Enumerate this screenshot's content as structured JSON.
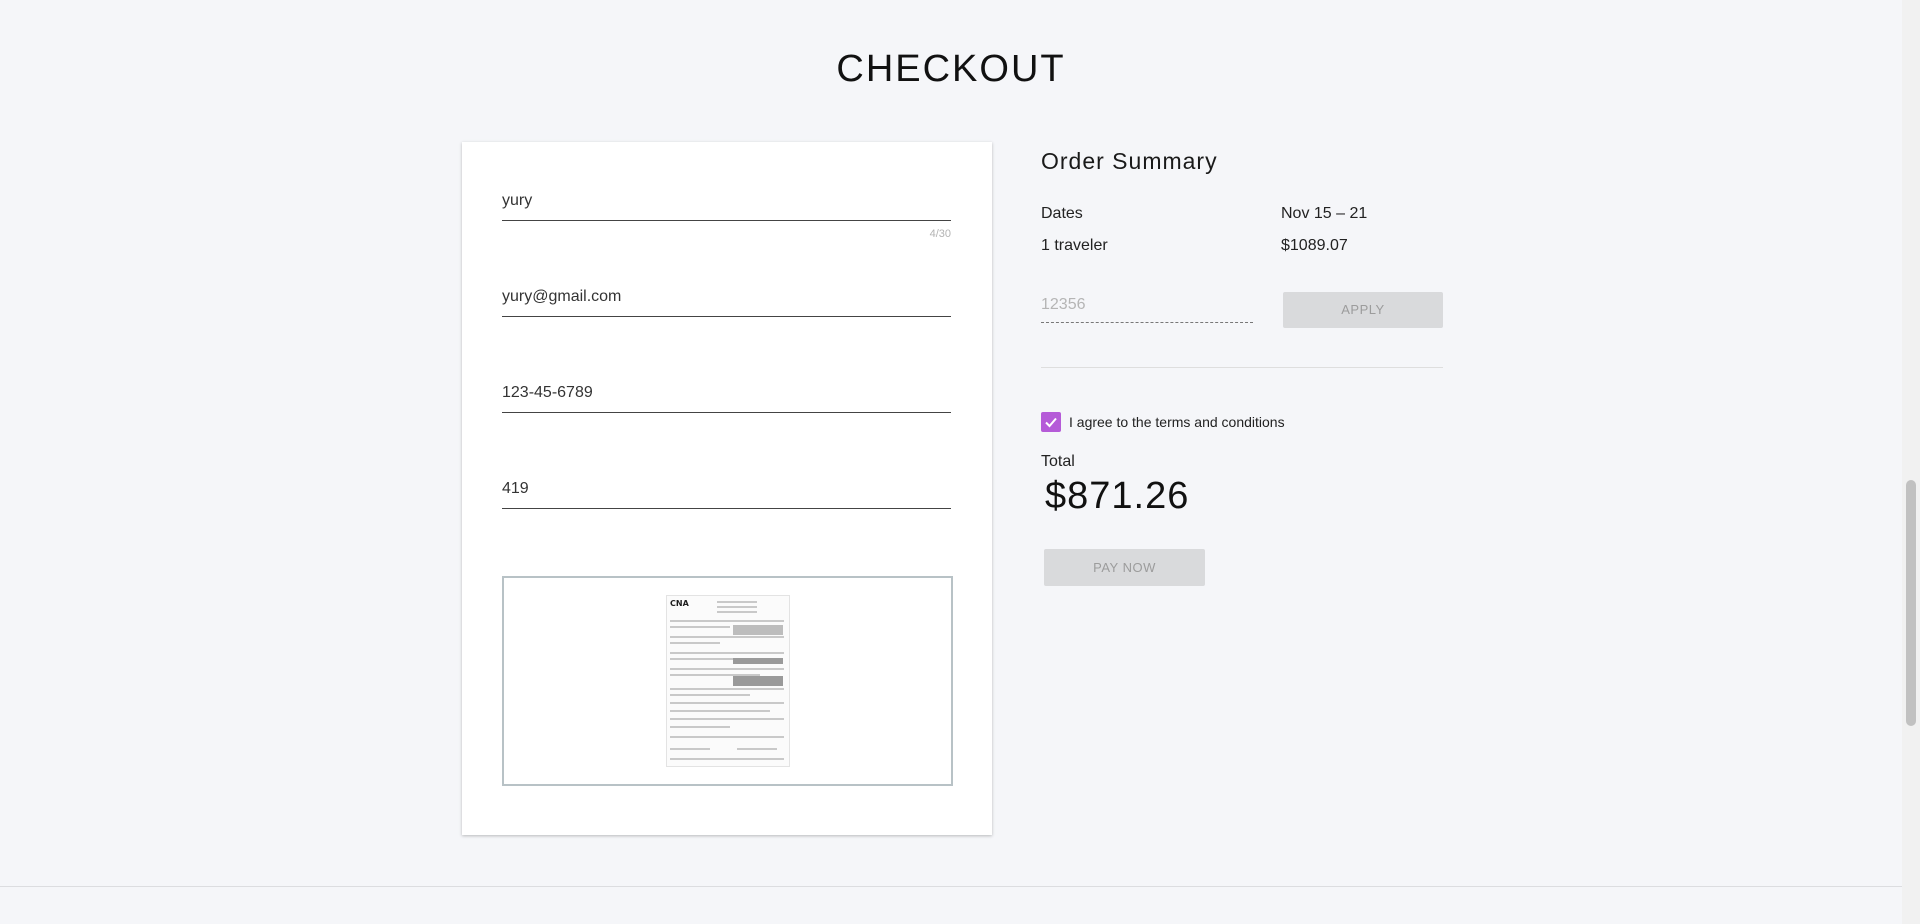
{
  "page": {
    "title": "CHECKOUT"
  },
  "form": {
    "name": {
      "value": "yury",
      "counter": "4/30"
    },
    "email": {
      "value": "yury@gmail.com"
    },
    "ssn": {
      "value": "123-45-6789"
    },
    "code": {
      "value": "419"
    },
    "document": {
      "logo_text": "CNA"
    }
  },
  "summary": {
    "title": "Order Summary",
    "rows": [
      {
        "label": "Dates",
        "value": "Nov 15 – 21"
      },
      {
        "label": "1 traveler",
        "value": "$1089.07"
      }
    ],
    "promo": {
      "placeholder": "12356",
      "apply_label": "APPLY"
    },
    "terms": {
      "label": "I agree to the terms and conditions",
      "checked": true
    },
    "total": {
      "label": "Total",
      "value": "$871.26"
    },
    "pay_label": "PAY NOW"
  },
  "colors": {
    "accent": "#b55bd8",
    "disabled_bg": "#d9dadc",
    "disabled_text": "#9c9c9c"
  },
  "icons": {
    "checkbox": "check-icon"
  }
}
